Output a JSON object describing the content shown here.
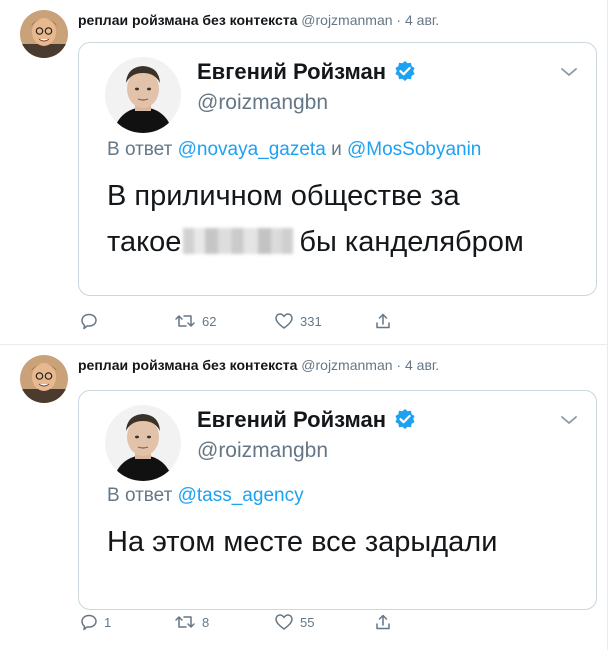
{
  "tweets": [
    {
      "author_name": "реплаи ройзмана без контекста",
      "author_handle": "@rojzmanman",
      "separator": "·",
      "date": "4 авг.",
      "quoted": {
        "name": "Евгений Ройзман",
        "handle": "@roizmangbn",
        "reply_prefix": "В ответ",
        "mentions": [
          "@novaya_gazeta",
          "@MosSobyanin"
        ],
        "mention_joiner": "и",
        "text_line1": "В приличном обществе за",
        "text_line2_before": "такое",
        "text_line2_after": "бы канделябром"
      },
      "actions": {
        "reply_count": "",
        "retweet_count": "62",
        "like_count": "331"
      }
    },
    {
      "author_name": "реплаи ройзмана без контекста",
      "author_handle": "@rojzmanman",
      "separator": "·",
      "date": "4 авг.",
      "quoted": {
        "name": "Евгений Ройзман",
        "handle": "@roizmangbn",
        "reply_prefix": "В ответ",
        "mentions": [
          "@tass_agency"
        ],
        "text": "На этом месте все зарыдали"
      },
      "actions": {
        "reply_count": "1",
        "retweet_count": "8",
        "like_count": "55"
      }
    }
  ],
  "icons": {
    "reply": "reply-icon",
    "retweet": "retweet-icon",
    "like": "heart-icon",
    "share": "share-icon",
    "verified": "verified-badge-icon",
    "more": "chevron-down-icon"
  },
  "colors": {
    "link": "#1da1f2",
    "secondary": "#657786",
    "border": "#ccd6dd"
  }
}
